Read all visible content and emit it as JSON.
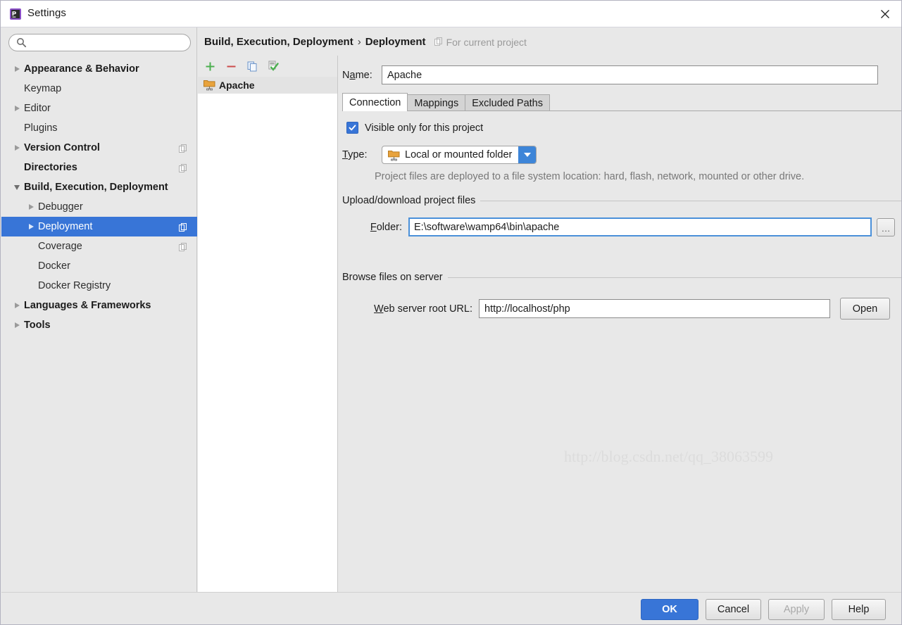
{
  "window": {
    "title": "Settings",
    "app_icon": "phpstorm-icon",
    "close_label": "✕"
  },
  "sidebar": {
    "search": {
      "value": "",
      "placeholder": "",
      "icon": "search-icon"
    },
    "items": [
      {
        "label": "Appearance & Behavior",
        "expander": "collapsed",
        "indent": 0,
        "bold": true,
        "badge": false
      },
      {
        "label": "Keymap",
        "expander": "none",
        "indent": 0,
        "bold": false,
        "badge": false
      },
      {
        "label": "Editor",
        "expander": "collapsed",
        "indent": 0,
        "bold": false,
        "badge": false
      },
      {
        "label": "Plugins",
        "expander": "none",
        "indent": 0,
        "bold": false,
        "badge": false
      },
      {
        "label": "Version Control",
        "expander": "collapsed",
        "indent": 0,
        "bold": true,
        "badge": true
      },
      {
        "label": "Directories",
        "expander": "none",
        "indent": 0,
        "bold": true,
        "badge": true
      },
      {
        "label": "Build, Execution, Deployment",
        "expander": "expanded",
        "indent": 0,
        "bold": true,
        "badge": false
      },
      {
        "label": "Debugger",
        "expander": "collapsed",
        "indent": 1,
        "bold": false,
        "badge": false
      },
      {
        "label": "Deployment",
        "expander": "collapsed",
        "indent": 1,
        "bold": false,
        "badge": true,
        "selected": true
      },
      {
        "label": "Coverage",
        "expander": "none",
        "indent": 1,
        "bold": false,
        "badge": true
      },
      {
        "label": "Docker",
        "expander": "none",
        "indent": 1,
        "bold": false,
        "badge": false
      },
      {
        "label": "Docker Registry",
        "expander": "none",
        "indent": 1,
        "bold": false,
        "badge": false
      },
      {
        "label": "Languages & Frameworks",
        "expander": "collapsed",
        "indent": 0,
        "bold": true,
        "badge": false
      },
      {
        "label": "Tools",
        "expander": "collapsed",
        "indent": 0,
        "bold": true,
        "badge": false
      }
    ]
  },
  "breadcrumb": {
    "parent": "Build, Execution, Deployment",
    "separator": "›",
    "current": "Deployment",
    "scope_label": "For current project",
    "scope_icon": "project-scope-icon"
  },
  "servers": {
    "toolbar": [
      {
        "name": "add-server-button",
        "icon": "plus-icon",
        "label": "+"
      },
      {
        "name": "remove-server-button",
        "icon": "minus-icon",
        "label": "−"
      },
      {
        "name": "copy-server-button",
        "icon": "copy-icon",
        "label": ""
      },
      {
        "name": "set-default-button",
        "icon": "checkmark-icon",
        "label": ""
      }
    ],
    "list": [
      {
        "name": "Apache",
        "icon": "deployment-folder-icon",
        "selected": true
      }
    ]
  },
  "editor": {
    "name_field": {
      "label": "Name:",
      "value": "Apache"
    },
    "tabs": [
      {
        "label": "Connection",
        "active": true
      },
      {
        "label": "Mappings",
        "active": false
      },
      {
        "label": "Excluded Paths",
        "active": false
      }
    ],
    "visible_only_checkbox": {
      "label": "Visible only for this project",
      "checked": true,
      "mark": "✓"
    },
    "type_field": {
      "label": "Type:",
      "value": "Local or mounted folder",
      "icon": "deployment-folder-icon",
      "hint": "Project files are deployed to a file system location: hard, flash, network, mounted or other drive."
    },
    "upload_group": {
      "title": "Upload/download project files",
      "folder_label": "Folder:",
      "folder_value": "E:\\software\\wamp64\\bin\\apache",
      "browse_label": "…"
    },
    "browse_group": {
      "title": "Browse files on server",
      "url_label": "Web server root URL:",
      "url_value": "http://localhost/php",
      "open_label": "Open"
    }
  },
  "footer": {
    "buttons": [
      {
        "label": "OK",
        "style": "primary",
        "name": "ok-button"
      },
      {
        "label": "Cancel",
        "style": "normal",
        "name": "cancel-button"
      },
      {
        "label": "Apply",
        "style": "disabled",
        "name": "apply-button"
      },
      {
        "label": "Help",
        "style": "normal",
        "name": "help-button"
      }
    ]
  },
  "watermark": {
    "line1": "http://blog.csdn.net/qq_38063599",
    "line2": "http://blog.csdn.net/qq_38063599"
  },
  "colors": {
    "accent": "#3875d7",
    "window_bg": "#e8e8e8",
    "field_bg": "#ffffff",
    "focus_border": "#4a90d9",
    "hint_text": "#787878"
  }
}
